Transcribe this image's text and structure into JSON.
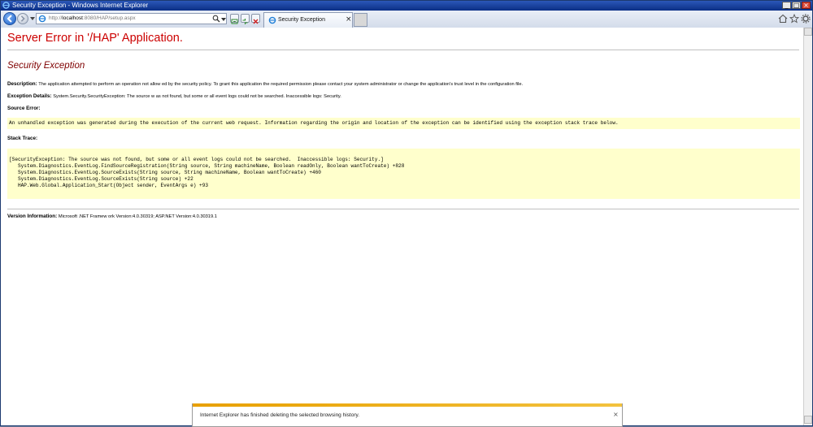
{
  "window": {
    "title": "Security Exception - Windows Internet Explorer",
    "controls": {
      "minimize": "_",
      "maximize": "□",
      "close": "×"
    }
  },
  "navbar": {
    "address": {
      "prefix": "http://",
      "host": "localhost",
      "rest": ":8080/HAP/setup.aspx"
    },
    "tab": {
      "title": "Security Exception",
      "close": "×"
    },
    "icons": [
      "back-icon",
      "forward-icon",
      "search-icon",
      "compatibility-icon",
      "refresh-icon",
      "stop-icon",
      "home-icon",
      "favorites-icon",
      "tools-icon"
    ]
  },
  "page": {
    "error_title": "Server Error in '/HAP' Application.",
    "exception_title": "Security Exception",
    "description_label": "Description:",
    "description_text": "The application attempted to perform an operation not allow ed by the security policy.  To grant this application the required permission please contact your system administrator or change the application's trust level in the configuration file.",
    "exception_details_label": "Exception Details:",
    "exception_details_text": "System.Security.SecurityException: The source w as not found, but some or all event logs could not be searched.  Inaccessible logs: Security.",
    "source_error_label": "Source Error:",
    "source_error_text": "An unhandled exception was generated during the execution of the current web request. Information regarding the origin and location of the exception can be identified using the exception stack trace below.",
    "stack_trace_label": "Stack Trace:",
    "stack_trace": [
      "[SecurityException: The source was not found, but some or all event logs could not be searched.  Inaccessible logs: Security.]",
      "   System.Diagnostics.EventLog.FindSourceRegistration(String source, String machineName, Boolean readOnly, Boolean wantToCreate) +828",
      "   System.Diagnostics.EventLog.SourceExists(String source, String machineName, Boolean wantToCreate) +460",
      "   System.Diagnostics.EventLog.SourceExists(String source) +22",
      "   HAP.Web.Global.Application_Start(Object sender, EventArgs e) +93"
    ],
    "version_label": "Version Information:",
    "version_text": "Microsoft .NET Framew ork Version:4.0.30319; ASP.NET Version:4.0.30319.1"
  },
  "notification": {
    "message": "Internet Explorer has finished deleting the selected browsing history.",
    "close": "×"
  },
  "colors": {
    "error_red": "#cc0000",
    "exception_maroon": "#7f0000",
    "code_background": "#ffffcc",
    "titlebar": "#0b2f86"
  }
}
